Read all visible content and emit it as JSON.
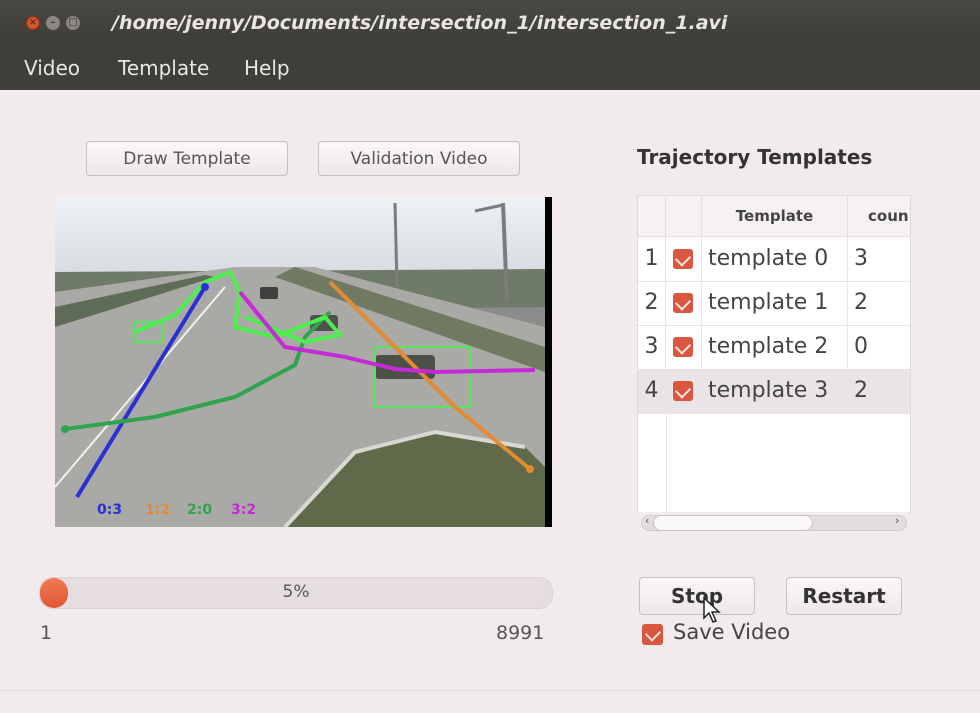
{
  "window": {
    "title": "/home/jenny/Documents/intersection_1/intersection_1.avi",
    "close_glyph": "×",
    "min_glyph": "–",
    "max_glyph": "□"
  },
  "menu": [
    "Video",
    "Template",
    "Help"
  ],
  "buttons": {
    "draw_template": "Draw Template",
    "validation_video": "Validation Video",
    "stop": "Stop",
    "restart": "Restart"
  },
  "video": {
    "legend": [
      {
        "label": "0:3",
        "color": "#2a2fd6"
      },
      {
        "label": "1:2",
        "color": "#e38a35"
      },
      {
        "label": "2:0",
        "color": "#2fa34d"
      },
      {
        "label": "3:2",
        "color": "#c52ad6"
      }
    ]
  },
  "templates_panel": {
    "title": "Trajectory Templates",
    "columns": [
      "Template",
      "coun"
    ],
    "rows": [
      {
        "index": "1",
        "checked": true,
        "name": "template 0",
        "count": "3",
        "selected": false
      },
      {
        "index": "2",
        "checked": true,
        "name": "template 1",
        "count": "2",
        "selected": false
      },
      {
        "index": "3",
        "checked": true,
        "name": "template 2",
        "count": "0",
        "selected": false
      },
      {
        "index": "4",
        "checked": true,
        "name": "template 3",
        "count": "2",
        "selected": true
      }
    ],
    "scroll": {
      "left": "‹",
      "right": "›"
    }
  },
  "progress": {
    "value": 5,
    "text": "5%",
    "min": "1",
    "max": "8991"
  },
  "save_video": {
    "label": "Save Video",
    "checked": true
  },
  "colors": {
    "accent": "#de5632",
    "titlebar": "#3f3e39",
    "background": "#f2ebee"
  }
}
